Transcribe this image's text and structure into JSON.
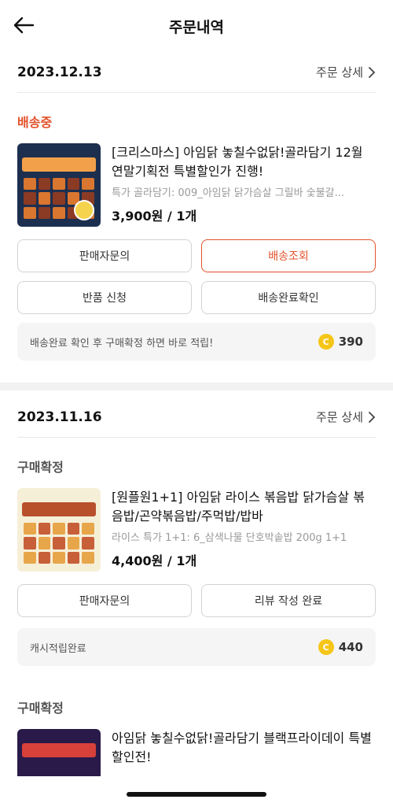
{
  "header": {
    "title": "주문내역",
    "back_icon": "back-arrow-icon"
  },
  "orders": [
    {
      "date": "2023.12.13",
      "detail_label": "주문 상세",
      "status": "배송중",
      "product": {
        "name": "[크리스마스] 아임닭 놓칠수없닭!골라담기 12월 연말기획전 특별할인가 진행!",
        "option": "특가 골라담기: 009_아임닭 닭가슴살 그릴바 숯불갈...",
        "price": "3,900원 / 1개"
      },
      "buttons": [
        "판매자문의",
        "배송조회",
        "반품 신청",
        "배송완료확인"
      ],
      "point": {
        "text": "배송완료 확인 후 구매확정 하면 바로 적립!",
        "amount": "390"
      }
    },
    {
      "date": "2023.11.16",
      "detail_label": "주문 상세",
      "status": "구매확정",
      "product": {
        "name": "[원플원1+1] 아임닭 라이스 볶음밥 닭가슴살 볶음밥/곤약볶음밥/주먹밥/밥바",
        "option": "라이스 특가 1+1: 6_삼색나물 단호박솥밥 200g 1+1",
        "price": "4,400원 / 1개"
      },
      "buttons": [
        "판매자문의",
        "리뷰 작성 완료"
      ],
      "point": {
        "text": "캐시적립완료",
        "amount": "440"
      }
    },
    {
      "status": "구매확정",
      "product": {
        "name": "아임닭 놓칠수없닭!골라담기 블랙프라이데이 특별할인전!"
      }
    }
  ],
  "coin_symbol": "C"
}
